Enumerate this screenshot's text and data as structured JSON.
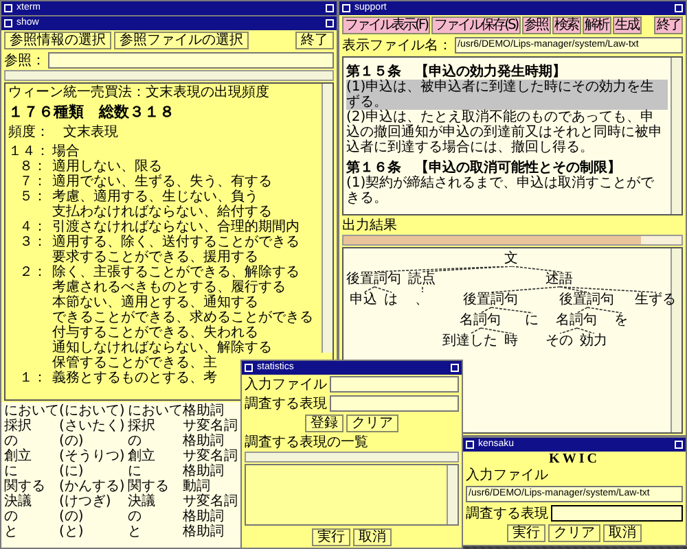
{
  "xterm": {
    "title": "xterm"
  },
  "show": {
    "title": "show",
    "buttons": [
      "参照情報の選択",
      "参照ファイルの選択"
    ],
    "quit": "終了",
    "ref_label": "参照：",
    "heading": "ウィーン統一売買法：文末表現の出現頻度",
    "summary": "１７６種類　総数３１８",
    "column_header": "頻度：　文末表現",
    "frequencies": [
      {
        "count": "１４：",
        "text": "場合"
      },
      {
        "count": "８：",
        "text": "適用しない、限る"
      },
      {
        "count": "７：",
        "text": "適用でない、生ずる、失う、有する"
      },
      {
        "count": "５：",
        "text": "考慮、適用する、生じない、負う"
      },
      {
        "text": "支払わなければならない、給付する"
      },
      {
        "count": "４：",
        "text": "引渡さなければならない、合理的期間内"
      },
      {
        "count": "３：",
        "text": "適用する、除く、送付することができる"
      },
      {
        "text": "要求することができる、援用する"
      },
      {
        "count": "２：",
        "text": "除く、主張することができる、解除する"
      },
      {
        "text": "考慮されるべきものとする、履行する"
      },
      {
        "text": "本節ない、適用とする、通知する"
      },
      {
        "text": "できることができる、求めることができる"
      },
      {
        "text": "付与することができる、失われる"
      },
      {
        "text": "通知しなければならない、解除する"
      },
      {
        "text": "保管することができる、主"
      },
      {
        "count": "１：",
        "text": "義務とするものとする、考"
      }
    ],
    "morph_rows": [
      [
        "において",
        "(において)",
        "において",
        "格助詞"
      ],
      [
        "採択",
        "(さいたく)",
        "採択",
        "サ変名詞"
      ],
      [
        "の",
        "(の)",
        "の",
        "格助詞"
      ],
      [
        "創立",
        "(そうりつ)",
        "創立",
        "サ変名詞"
      ],
      [
        "に",
        "(に)",
        "に",
        "格助詞"
      ],
      [
        "関する",
        "(かんする)",
        "関する",
        "動詞"
      ],
      [
        "決議",
        "(けつぎ)",
        "決議",
        "サ変名詞"
      ],
      [
        "の",
        "(の)",
        "の",
        "格助詞"
      ],
      [
        "と",
        "(と)",
        "と",
        "格助詞"
      ]
    ]
  },
  "support": {
    "title": "support",
    "menu": [
      "ファイル表示(F)",
      "ファイル保存(S)",
      "参照",
      "検索",
      "解析",
      "生成"
    ],
    "quit": "終了",
    "file_label": "表示ファイル名：",
    "file_value": "/usr6/DEMO/Lips-manager/system/Law-txt",
    "paragraphs": [
      {
        "kind": "heading",
        "text": "第１５条　【申込の効力発生時期】",
        "selected": false
      },
      {
        "kind": "clause",
        "text": "(1)申込は、被申込者に到達した時にその効力を生ずる。",
        "selected": true
      },
      {
        "kind": "clause",
        "text": "(2)申込は、たとえ取消不能のものであっても、申込の撤回通知が申込の到達前又はそれと同時に被申込者に到達する場合には、撤回し得る。",
        "selected": false
      },
      {
        "kind": "heading",
        "text": "第１６条　【申込の取消可能性とその制限】",
        "selected": false
      },
      {
        "kind": "clause",
        "text": "(1)契約が締結されるまで、申込は取消すことができる。",
        "selected": false
      }
    ],
    "output_label": "出力結果",
    "parse_tree": {
      "label": "文",
      "children": [
        {
          "label": "後置詞句",
          "children": [
            {
              "label": "申込"
            },
            {
              "label": "は"
            }
          ]
        },
        {
          "label": "読点",
          "children": [
            {
              "label": "、"
            }
          ]
        },
        {
          "label": "述語",
          "children": [
            {
              "label": "後置詞句",
              "children": [
                {
                  "label": "名詞句",
                  "children": [
                    {
                      "label": "到達した"
                    },
                    {
                      "label": "時"
                    }
                  ]
                },
                {
                  "label": "に"
                }
              ]
            },
            {
              "label": "後置詞句",
              "children": [
                {
                  "label": "名詞句",
                  "children": [
                    {
                      "label": "その"
                    },
                    {
                      "label": "効力"
                    }
                  ]
                },
                {
                  "label": "を"
                }
              ]
            },
            {
              "label": "生ずる"
            }
          ]
        }
      ]
    }
  },
  "statistics": {
    "title": "statistics",
    "input_label": "入力ファイル",
    "expr_label": "調査する表現",
    "buttons": [
      "登録",
      "クリア"
    ],
    "list_label": "調査する表現の一覧",
    "actions": [
      "実行",
      "取消"
    ]
  },
  "kensaku": {
    "title": "kensaku",
    "heading": "KWIC",
    "input_label": "入力ファイル",
    "input_value": "/usr6/DEMO/Lips-manager/system/Law-txt",
    "expr_label": "調査する表現",
    "buttons": [
      "実行",
      "クリア",
      "取消"
    ]
  }
}
